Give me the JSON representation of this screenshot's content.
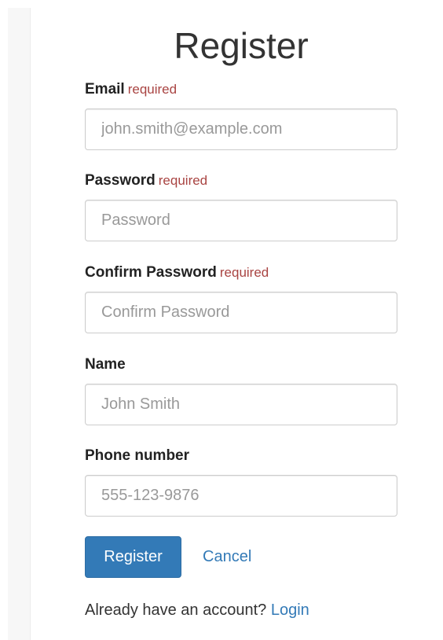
{
  "page": {
    "title": "Register"
  },
  "form": {
    "email": {
      "label": "Email",
      "required": "required",
      "placeholder": "john.smith@example.com",
      "value": ""
    },
    "password": {
      "label": "Password",
      "required": "required",
      "placeholder": "Password",
      "value": ""
    },
    "confirm_password": {
      "label": "Confirm Password",
      "required": "required",
      "placeholder": "Confirm Password",
      "value": ""
    },
    "name": {
      "label": "Name",
      "placeholder": "John Smith",
      "value": ""
    },
    "phone": {
      "label": "Phone number",
      "placeholder": "555-123-9876",
      "value": ""
    }
  },
  "actions": {
    "register_label": "Register",
    "cancel_label": "Cancel"
  },
  "footer": {
    "prompt": "Already have an account?",
    "login_label": "Login"
  },
  "colors": {
    "primary": "#337ab7",
    "required": "#a94442",
    "input_border": "#cccccc",
    "placeholder": "#999999"
  }
}
